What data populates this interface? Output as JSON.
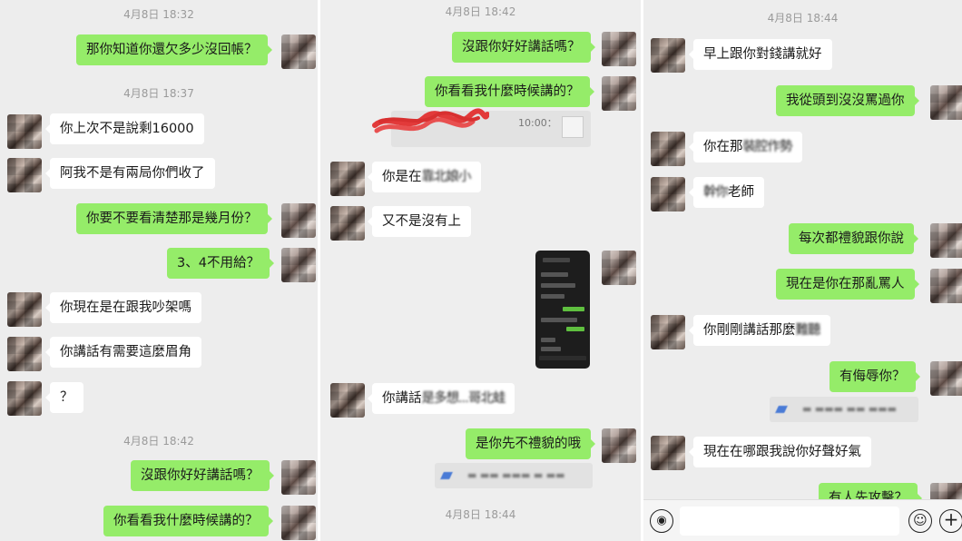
{
  "panel1": {
    "timestamps": [
      "4月8日 18:32",
      "4月8日 18:37",
      "4月8日 18:42"
    ],
    "messages": [
      "那你知道你還欠多少沒回帳？",
      "你上次不是說剩16000",
      "阿我不是有兩局你們收了",
      "你要不要看清楚那是幾月份？",
      "3、4不用給？",
      "你現在是在跟我吵架嗎",
      "你講話有需要這麼眉角",
      "？",
      "沒跟你好好講話嗎？",
      "你看看我什麼時候講的？"
    ]
  },
  "panel2": {
    "timestamps": [
      "4月8日 18:42",
      "4月8日 18:44"
    ],
    "messages": [
      "沒跟你好好講話嗎？",
      "你看看我什麼時候講的？",
      "你是在",
      "又不是沒有上",
      "你講話",
      "是你先不禮貌的哦"
    ],
    "quote_time": "10:00：",
    "blurred": [
      "靠北娘小",
      "是多想...哥北蛙"
    ]
  },
  "panel3": {
    "timestamps": [
      "4月8日 18:44"
    ],
    "messages": [
      "早上跟你對錢講就好",
      "我從頭到沒沒罵過你",
      "你在那",
      "老師",
      "每次都禮貌跟你說",
      "現在是你在那亂罵人",
      "你剛剛講話那麼",
      "有侮辱你？",
      "現在在哪跟我說你好聲好氣",
      "有人先攻擊？"
    ],
    "blurred": [
      "裝腔作勢",
      "幹你",
      "難聽"
    ]
  },
  "input_bar": {
    "voice_icon": "voice-icon",
    "emoji_icon": "emoji-icon",
    "plus_icon": "plus-icon"
  },
  "colors": {
    "outgoing": "#95ec69",
    "incoming": "#ffffff",
    "background": "#ededed"
  }
}
